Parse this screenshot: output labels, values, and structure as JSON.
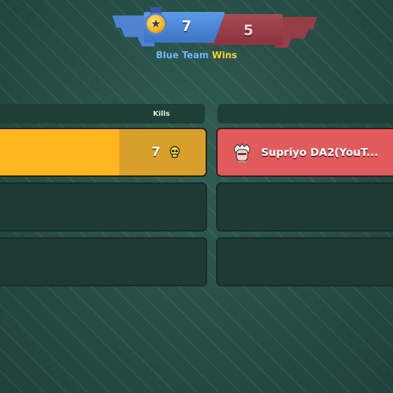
{
  "scoreboard": {
    "blue_score": "7",
    "red_score": "5",
    "result_team": "Blue Team",
    "result_outcome": "Wins",
    "blue_color": "#4a86d6",
    "red_color": "#9a3d46"
  },
  "table": {
    "kills_header": "Kills",
    "blue_rows": [
      {
        "kills": "7",
        "icon": "skull-icon",
        "highlight_color": "#ffb51f"
      }
    ],
    "red_rows": [
      {
        "player": "Supriyo DA2(YouT...",
        "icon": "avatar-icon",
        "highlight_color": "#e15a5c"
      }
    ]
  }
}
